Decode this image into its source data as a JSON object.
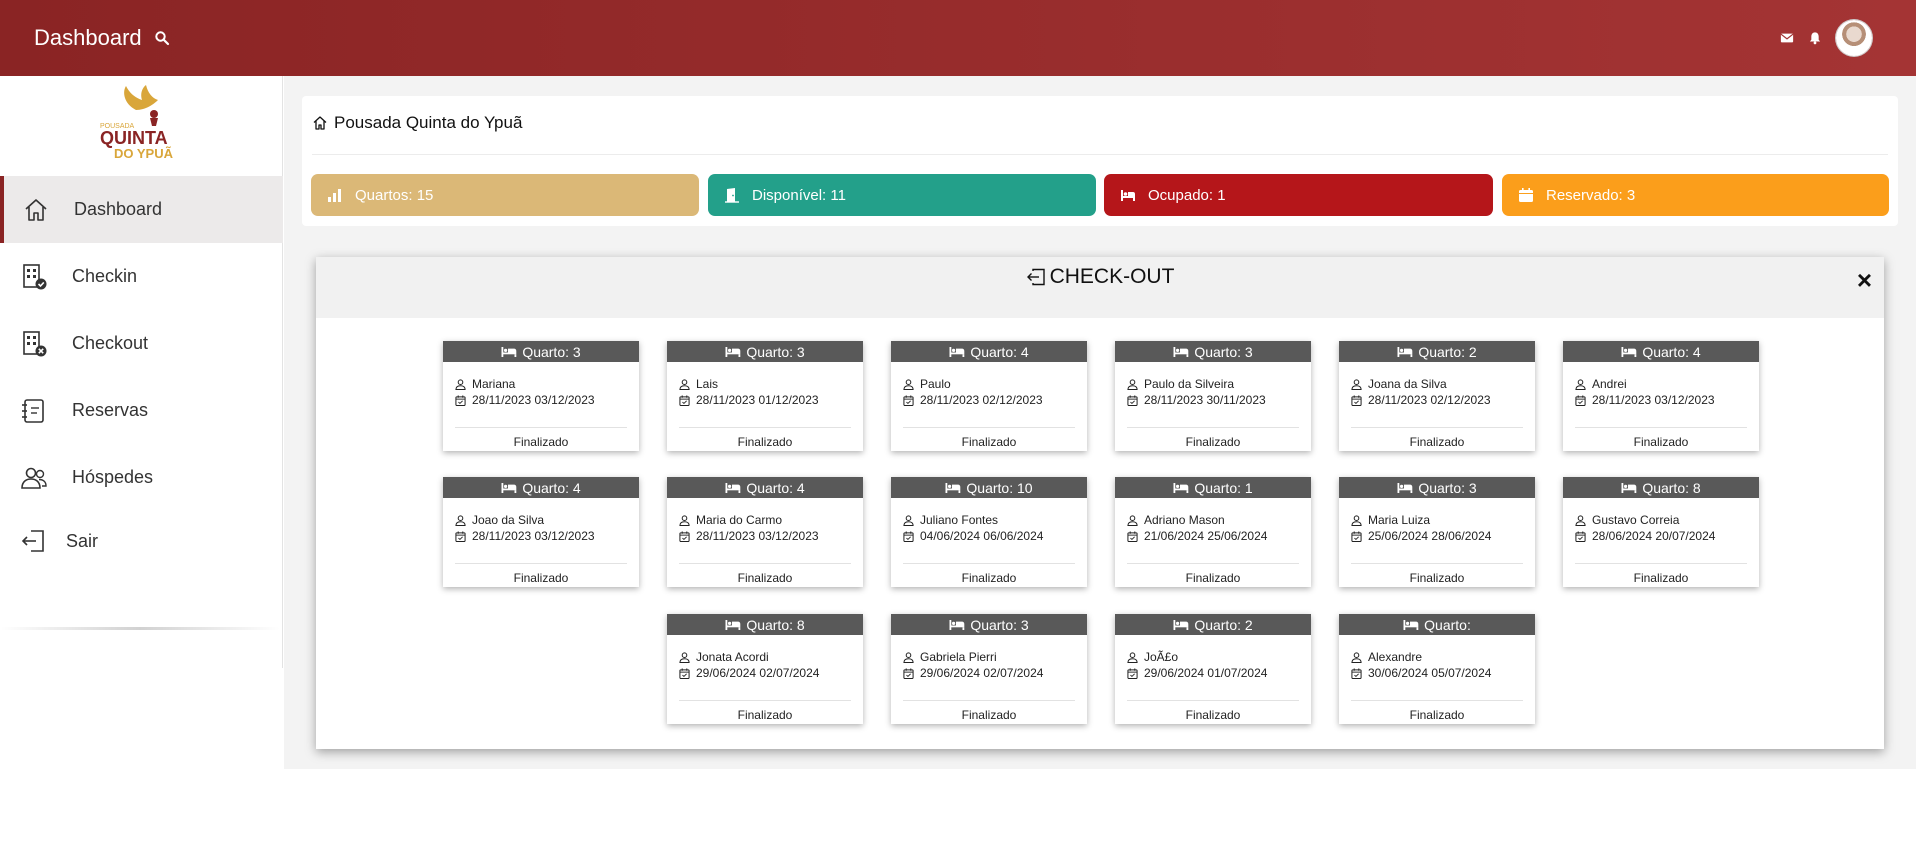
{
  "header": {
    "title": "Dashboard"
  },
  "logo": {
    "line1": "POUSADA",
    "line2": "QUINTA",
    "line3": "DO YPUÃ"
  },
  "sidebar": {
    "items": [
      {
        "label": "Dashboard",
        "icon": "home-icon"
      },
      {
        "label": "Checkin",
        "icon": "building-check-icon"
      },
      {
        "label": "Checkout",
        "icon": "building-x-icon"
      },
      {
        "label": "Reservas",
        "icon": "journal-icon"
      },
      {
        "label": "Hóspedes",
        "icon": "people-icon"
      },
      {
        "label": "Sair",
        "icon": "logout-icon"
      }
    ]
  },
  "page": {
    "breadcrumb": "Pousada Quinta do Ypuã"
  },
  "stats": {
    "rooms": "Quartos: 15",
    "available": "Disponível: 11",
    "occupied": "Ocupado: 1",
    "reserved": "Reservado: 3"
  },
  "modal": {
    "title": "CHECK-OUT",
    "close": "×"
  },
  "colors": {
    "topbar": "#8a2424",
    "rooms": "#dbb877",
    "available": "#23a08a",
    "occupied": "#b5161a",
    "reserved": "#fb9e1b",
    "card_header": "#595959"
  },
  "cards": [
    {
      "room": "Quarto: 3",
      "guest": "Mariana",
      "dates": "28/11/2023 03/12/2023",
      "status": "Finalizado"
    },
    {
      "room": "Quarto: 3",
      "guest": "Lais",
      "dates": "28/11/2023 01/12/2023",
      "status": "Finalizado"
    },
    {
      "room": "Quarto: 4",
      "guest": "Paulo",
      "dates": "28/11/2023 02/12/2023",
      "status": "Finalizado"
    },
    {
      "room": "Quarto: 3",
      "guest": "Paulo da Silveira",
      "dates": "28/11/2023 30/11/2023",
      "status": "Finalizado"
    },
    {
      "room": "Quarto: 2",
      "guest": "Joana da Silva",
      "dates": "28/11/2023 02/12/2023",
      "status": "Finalizado"
    },
    {
      "room": "Quarto: 4",
      "guest": "Andrei",
      "dates": "28/11/2023 03/12/2023",
      "status": "Finalizado"
    },
    {
      "room": "Quarto: 4",
      "guest": "Joao da Silva",
      "dates": "28/11/2023 03/12/2023",
      "status": "Finalizado"
    },
    {
      "room": "Quarto: 4",
      "guest": "Maria do Carmo",
      "dates": "28/11/2023 03/12/2023",
      "status": "Finalizado"
    },
    {
      "room": "Quarto: 10",
      "guest": "Juliano Fontes",
      "dates": "04/06/2024 06/06/2024",
      "status": "Finalizado"
    },
    {
      "room": "Quarto: 1",
      "guest": "Adriano Mason",
      "dates": "21/06/2024 25/06/2024",
      "status": "Finalizado"
    },
    {
      "room": "Quarto: 3",
      "guest": "Maria Luiza",
      "dates": "25/06/2024 28/06/2024",
      "status": "Finalizado"
    },
    {
      "room": "Quarto: 8",
      "guest": "Gustavo Correia",
      "dates": "28/06/2024 20/07/2024",
      "status": "Finalizado"
    },
    {
      "room": "Quarto: 8",
      "guest": "Jonata Acordi",
      "dates": "29/06/2024 02/07/2024",
      "status": "Finalizado"
    },
    {
      "room": "Quarto: 3",
      "guest": "Gabriela Pierri",
      "dates": "29/06/2024 02/07/2024",
      "status": "Finalizado"
    },
    {
      "room": "Quarto: 2",
      "guest": "JoÃ£o",
      "dates": "29/06/2024 01/07/2024",
      "status": "Finalizado"
    },
    {
      "room": "Quarto:",
      "guest": "Alexandre",
      "dates": "30/06/2024 05/07/2024",
      "status": "Finalizado"
    }
  ]
}
